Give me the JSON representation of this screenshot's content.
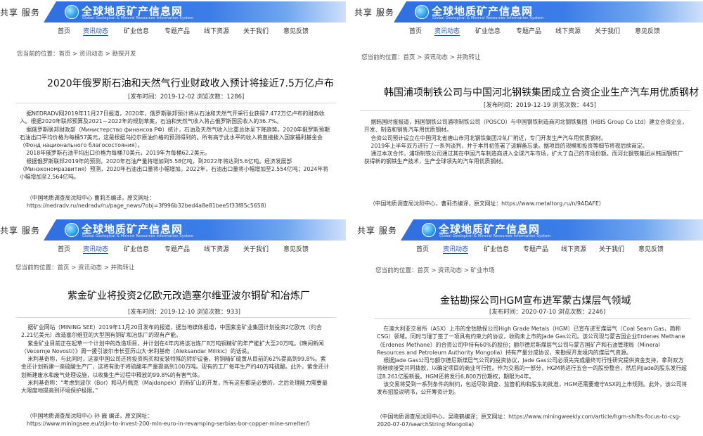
{
  "site": {
    "share_label": "共享 服务",
    "logo_cn": "全球地质矿产信息网",
    "logo_en": "Global Geological & Mineral Resources Information System"
  },
  "nav": [
    "首页",
    "资讯动态",
    "矿业信息",
    "专题产品",
    "线下资源",
    "关于我们",
    "意见反馈"
  ],
  "articles": [
    {
      "breadcrumb": "您当前的位置：首页 > 资讯动态 > 勘探开发",
      "title": "2020年俄罗斯石油和天然气行业财政收入预计将接近7.5万亿卢布",
      "meta": "[发布时间：2019-12-02 浏览次数：1286]",
      "paragraphs": [
        "据NEDRADV网2019年11月27日报道，2020年，俄罗斯联邦预计将从石油和天然气开采行业获得7.472万亿卢布的财政收入。根据2020年联邦预算及2021－2022年的规划草案，石油和天然气收入将占俄罗斯国民收入的36.7%。",
        "据俄罗斯联邦财政部（Министерство финансов РФ）统计，石油及天然气收入比重总体呈下降趋势。2020年俄罗斯预期石油出口平均价格为每桶57美元，这是根据乌拉尔原油价格的预测得到的。所有高于此水平的收入将直接拨入国家福利基金会（Фонд национального благосостояния）。",
        "2018年俄罗斯石油平均出口价格为每桶70美元，2019年为每桶62.2美元。",
        "根据俄罗斯联邦2019年的预测，2020年石油产量将增加到5.58亿吨，到2022年将达到5.6亿吨。经济发展部（Минэкономразвития）预测，2020年石油出口量将小幅增加。2022年，石油出口量将小幅增加至2.554亿吨；2024年将小幅增加至2.564亿吨。"
      ],
      "footer": "（中国地质调查局沈阳中心 曹莉杰编译，原文网址：",
      "source_url": "https://nedradv.ru/nedradv/ru/page_news/?obj=3f996b32bed4a8e81bee5f33f85c5658）"
    },
    {
      "breadcrumb": "您当前的位置：首页 > 资讯动态 > 并购转让",
      "title": "韩国浦项制铁公司与中国河北钢铁集团成立合资企业生产汽车用优质钢材",
      "meta": "[发布时间：2019-12-19 浏览次数：445]",
      "paragraphs": [
        "据韩国时报报道，韩国钢铁公司浦项制铁公司（POSCO）与中国钢铁制造商河北钢铁集团（HBIS Group Co Ltd）建立合资企业，开发、制造和销售汽车用优质钢材。",
        "合资公司预计设立在中国河北省唐山市河北钢铁集团冷轧厂附近，专门开发生产汽车用优质钢材。",
        "2019年上半年双方进行了一系列谈判，并于本月初签署了谅解备忘录。据项目的规模和投资等细节将视后续商定。",
        "通过本次合作，浦项制铁公司通过其在中国汽车制造商进入全球汽车市场，扩大了自己的市场份额。而河北钢铁集团从韩国钢铁厂获得新的钢铁生产技术，生产全球领先的汽车用优质钢材。"
      ],
      "footer": "（中国地质调查局沈阳中心，曹莉杰编译，原文网址：https://www.metaltorg.ru/n/9ADAFE）",
      "source_url": ""
    },
    {
      "breadcrumb": "您当前的位置：首页 > 资讯动态 > 并购转让",
      "title": "紫金矿业将投资2亿欧元改造塞尔维亚波尔铜矿和冶炼厂",
      "meta": "[发布时间：2019-12-10 浏览次数：933]",
      "paragraphs": [
        "据矿业网站（MINING SEE）2019年11月20日发布的报道，据当地媒体报道，中国紫金矿业集团计划投资2亿欧元（约合2.21亿美元）改造塞尔维亚的大型国有铜矿和冶炼厂的现有产能。",
        "紫金矿业目前正在起草一个计划中的改造项目，并计划在4年内将该冶炼厂8万吨铜精矿的年产能扩大至20万吨。《晚间新闻（Vecernje Novosti）》周一援引波尔市长亚历山大·米利基奇（Aleksandar Milikic）的话说。",
        "米利基奇称，与此同时，这家中国公司还将投资购买和安装特殊的转炉设备，将铜精矿硫黄从目前的62%提高到99.8%。紫金还计划新建一座硫酸生产厂，这将有助于将硫酸年产量提高到100万吨。现有的工厂每年生产约40万吨硫酸。此外，紫金还计划新建废水和废气处理设施，以收集生产过程中释放的99.8%的有害气体。",
        "米利基奇称：“考虑到波尔（Bor）和马丹佩克（Majdanpek）的新矿山的开发，所有这些都是必要的，之后处理能力需要最大限度地提高到环境保护极限。”"
      ],
      "footer": "（中国地质调查局沈阳中心 孙 巍 编译，原文网址：",
      "source_url": "https://www.miningsee.eu/zijin-to-invest-200-mln-euro-in-revamping-serbias-bor-copper-mine-smelter/）"
    },
    {
      "breadcrumb": "您当前的位置：首页 > 资讯动态 > 矿业市场",
      "title": "金钴勘探公司HGM宣布进军蒙古煤层气领域",
      "meta": "[发布时间：2020-07-10 浏览次数：2246]",
      "paragraphs": [
        "在澳大利亚交易所（ASX）上市的金钴勘探公司High Grade Metals（HGM）已宣布进军煤层气（Coal Seam Gas，简称CSG）领域。同时与瑞丁签了一项具有约束力的协议，收购未上市的Jade Gas公司。该公司现与蒙古国企业Erdenes Methane（Erdenes Methane）的合资公司中持有60%的股份；额尔德尼斯煤层气公司与蒙古国矿产和石油管理局（Mineral Resources and Petroleum Authority Mongolia）持有产量分成协议，来勘探开发境内的煤层气资源。",
        "根据Jade Gas公司与额尔德尼斯煤层气公司的投资协议，Jade Gas公司必须先完成最终可行性研究提供资金支持，拿到双方将继续接受共同拨款，以确定项目的商业可行性。作为交易的一部分，HGM将进行五合一的股份整合，然后向Jade的股东发行超过8.261亿股新股。HGM还将发行6,800万份期权，期限为4年。",
        "该交易将受到一系列条件的制约，包括尽职调查、监管机构和股东的批准，HGM还需要遵守ASX的上市规则。此外，该公司将发布招股说明书，公开筹资计划。"
      ],
      "footer": "（中国地质调查局沈阳中心，吴晓鹤编译；原文网址：https://www.miningweekly.com/article/hgm-shifts-focus-to-csg-2020-07-07/searchString:Mongolia）",
      "source_url": ""
    }
  ],
  "colors": {
    "banner_blue": "#2f6fe0",
    "nav_active": "#1a4fb0",
    "title_text": "#111111"
  }
}
